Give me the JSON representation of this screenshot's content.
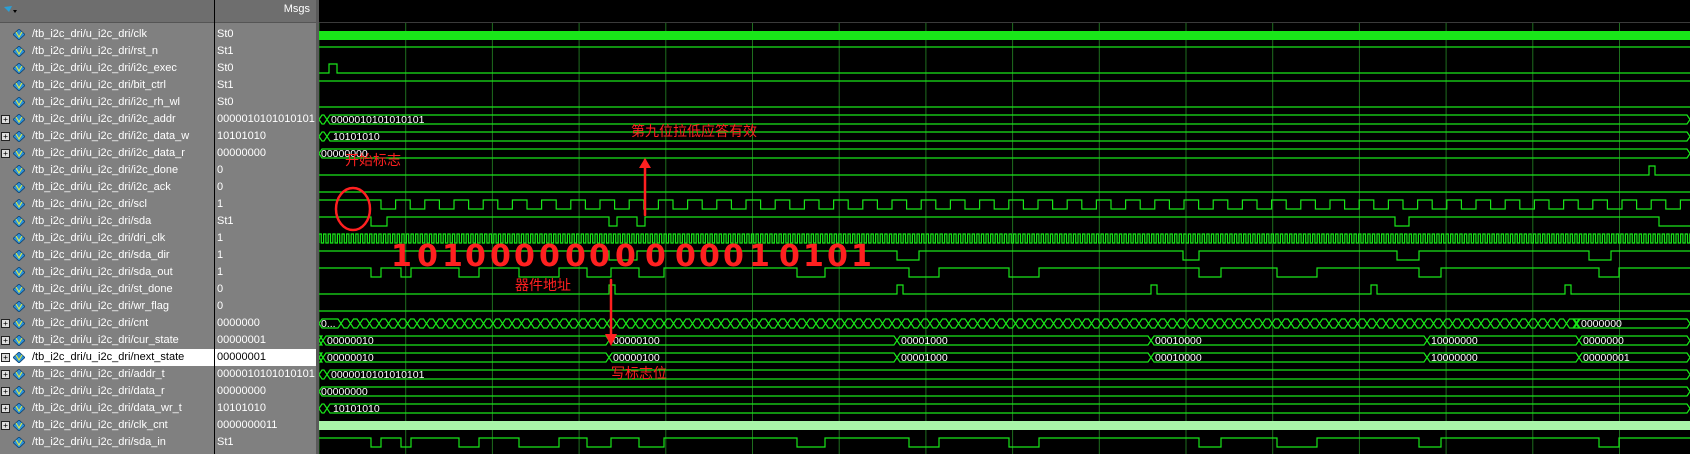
{
  "header": {
    "msgs_label": "Msgs",
    "menu_icon": "dropdown-arrow-icon"
  },
  "signals": [
    {
      "name": "/tb_i2c_dri/u_i2c_dri/clk",
      "value": "St0",
      "expandable": false
    },
    {
      "name": "/tb_i2c_dri/u_i2c_dri/rst_n",
      "value": "St1",
      "expandable": false
    },
    {
      "name": "/tb_i2c_dri/u_i2c_dri/i2c_exec",
      "value": "St0",
      "expandable": false
    },
    {
      "name": "/tb_i2c_dri/u_i2c_dri/bit_ctrl",
      "value": "St1",
      "expandable": false
    },
    {
      "name": "/tb_i2c_dri/u_i2c_dri/i2c_rh_wl",
      "value": "St0",
      "expandable": false
    },
    {
      "name": "/tb_i2c_dri/u_i2c_dri/i2c_addr",
      "value": "0000010101010101",
      "expandable": true
    },
    {
      "name": "/tb_i2c_dri/u_i2c_dri/i2c_data_w",
      "value": "10101010",
      "expandable": true
    },
    {
      "name": "/tb_i2c_dri/u_i2c_dri/i2c_data_r",
      "value": "00000000",
      "expandable": true
    },
    {
      "name": "/tb_i2c_dri/u_i2c_dri/i2c_done",
      "value": "0",
      "expandable": false
    },
    {
      "name": "/tb_i2c_dri/u_i2c_dri/i2c_ack",
      "value": "0",
      "expandable": false
    },
    {
      "name": "/tb_i2c_dri/u_i2c_dri/scl",
      "value": "1",
      "expandable": false
    },
    {
      "name": "/tb_i2c_dri/u_i2c_dri/sda",
      "value": "St1",
      "expandable": false
    },
    {
      "name": "/tb_i2c_dri/u_i2c_dri/dri_clk",
      "value": "1",
      "expandable": false
    },
    {
      "name": "/tb_i2c_dri/u_i2c_dri/sda_dir",
      "value": "1",
      "expandable": false
    },
    {
      "name": "/tb_i2c_dri/u_i2c_dri/sda_out",
      "value": "1",
      "expandable": false
    },
    {
      "name": "/tb_i2c_dri/u_i2c_dri/st_done",
      "value": "0",
      "expandable": false
    },
    {
      "name": "/tb_i2c_dri/u_i2c_dri/wr_flag",
      "value": "0",
      "expandable": false
    },
    {
      "name": "/tb_i2c_dri/u_i2c_dri/cnt",
      "value": "0000000",
      "expandable": true
    },
    {
      "name": "/tb_i2c_dri/u_i2c_dri/cur_state",
      "value": "00000001",
      "expandable": true
    },
    {
      "name": "/tb_i2c_dri/u_i2c_dri/next_state",
      "value": "00000001",
      "expandable": true,
      "selected": true
    },
    {
      "name": "/tb_i2c_dri/u_i2c_dri/addr_t",
      "value": "0000010101010101",
      "expandable": true
    },
    {
      "name": "/tb_i2c_dri/u_i2c_dri/data_r",
      "value": "00000000",
      "expandable": true
    },
    {
      "name": "/tb_i2c_dri/u_i2c_dri/data_wr_t",
      "value": "10101010",
      "expandable": true
    },
    {
      "name": "/tb_i2c_dri/u_i2c_dri/clk_cnt",
      "value": "0000000011",
      "expandable": true
    },
    {
      "name": "/tb_i2c_dri/u_i2c_dri/sda_in",
      "value": "St1",
      "expandable": false
    }
  ],
  "bus_labels": {
    "i2c_addr": [
      "0000010101010101"
    ],
    "i2c_data_w": [
      "10101010"
    ],
    "i2c_data_r": [
      "00000000"
    ],
    "cnt": [
      "0...",
      "0000000"
    ],
    "cur_state": [
      "00000010",
      "00000100",
      "00001000",
      "00010000",
      "10000000",
      "0000000"
    ],
    "next_state": [
      "00000010",
      "00000100",
      "00001000",
      "00010000",
      "10000000",
      "00000001"
    ],
    "addr_t": [
      "0000010101010101"
    ],
    "data_r": [
      "00000000"
    ],
    "data_wr_t": [
      "10101010"
    ]
  },
  "annotations": {
    "start_flag": "开始标志",
    "ninth_bit": "第九位拉低应答有效",
    "device_addr": "器件地址",
    "write_flag": "写标志位",
    "bits": [
      "1",
      "0",
      "1",
      "0",
      "0",
      "0",
      "0",
      "0",
      "0",
      "0",
      "0",
      "0",
      "0",
      "0",
      "1",
      "0",
      "1",
      "0",
      "1"
    ]
  },
  "colors": {
    "wave": "#19e619",
    "grid": "#1e6e1e",
    "panel": "#808080",
    "annotation": "#ff2020",
    "background": "#000000"
  }
}
